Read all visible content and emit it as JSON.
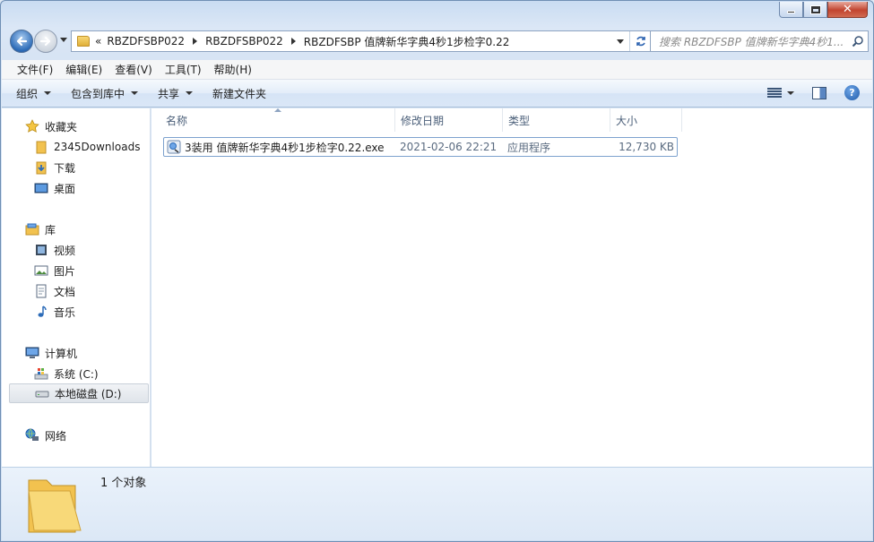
{
  "window": {
    "controls": {
      "minimize_icon": "minimize-icon",
      "maximize_icon": "maximize-icon",
      "close_icon": "close-icon"
    }
  },
  "nav": {
    "back_icon": "back-arrow-icon",
    "forward_icon": "forward-arrow-icon",
    "overflow_label": "«",
    "breadcrumb": [
      "RBZDFSBP022",
      "RBZDFSBP022",
      "RBZDFSBP 值牌新华字典4秒1步检字0.22"
    ],
    "search_placeholder": "搜索 RBZDFSBP 值牌新华字典4秒1..."
  },
  "menubar": [
    "文件(F)",
    "编辑(E)",
    "查看(V)",
    "工具(T)",
    "帮助(H)"
  ],
  "commandbar": {
    "organize": "组织",
    "include_in_library": "包含到库中",
    "share": "共享",
    "new_folder": "新建文件夹"
  },
  "sidebar": {
    "favorites": {
      "label": "收藏夹",
      "items": [
        "2345Downloads",
        "下载",
        "桌面"
      ]
    },
    "libraries": {
      "label": "库",
      "items": [
        "视频",
        "图片",
        "文档",
        "音乐"
      ]
    },
    "computer": {
      "label": "计算机",
      "items": [
        "系统 (C:)",
        "本地磁盘 (D:)"
      ]
    },
    "network": {
      "label": "网络"
    }
  },
  "columns": [
    "名称",
    "修改日期",
    "类型",
    "大小"
  ],
  "files": [
    {
      "name": "3装用 值牌新华字典4秒1步检字0.22.exe",
      "modified": "2021-02-06 22:21",
      "type": "应用程序",
      "size": "12,730 KB"
    }
  ],
  "details": {
    "count": "1 个对象"
  },
  "colors": {
    "accent": "#2d6cb8",
    "selection_border": "#7da2ce",
    "folder": "#f2c24f"
  }
}
